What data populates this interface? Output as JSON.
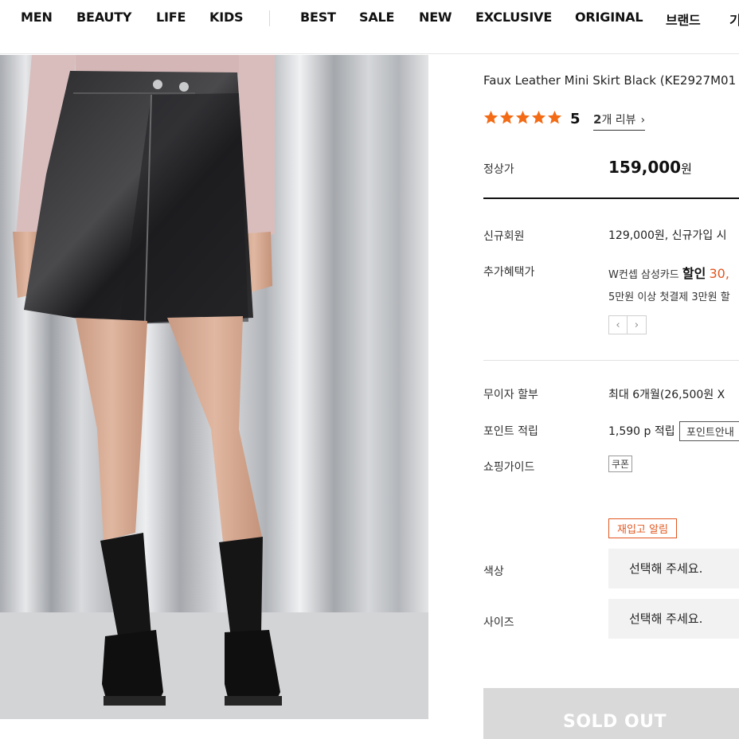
{
  "nav": {
    "items": [
      "MEN",
      "BEAUTY",
      "LIFE",
      "KIDS",
      "BEST",
      "SALE",
      "NEW",
      "EXCLUSIVE",
      "ORIGINAL",
      "브랜드",
      "기"
    ]
  },
  "product": {
    "name": "Faux Leather Mini Skirt Black (KE2927M01",
    "rating_value": 5,
    "rating_display": "5",
    "star_count": 5,
    "reviews_count": "2",
    "reviews_suffix": "개 리뷰",
    "list_price_label": "정상가",
    "list_price": "159,000",
    "currency": "원"
  },
  "benefits": {
    "new_member_label": "신규회원",
    "new_member_value": "129,000원, 신규가입 시",
    "extra_label": "추가혜택가",
    "extra_card": "W컨셉 삼성카드",
    "extra_discount_word": "할인",
    "extra_discount_amount": "30,",
    "extra_line2": "5만원 이상 첫결제 3만원 할",
    "prev_icon": "chevron-left-icon",
    "next_icon": "chevron-right-icon",
    "prev_glyph": "‹",
    "next_glyph": "›"
  },
  "payment": {
    "installment_label": "무이자 할부",
    "installment_value": "최대 6개월(26,500원 X",
    "points_label": "포인트 적립",
    "points_value": "1,590 p 적립",
    "points_guide_button": "포인트안내",
    "guide_label": "쇼핑가이드",
    "coupon_badge": "쿠폰"
  },
  "options": {
    "restock_button": "재입고 알림",
    "color_label": "색상",
    "color_placeholder": "선택해 주세요.",
    "size_label": "사이즈",
    "size_placeholder": "선택해 주세요."
  },
  "actions": {
    "soldout_label": "SOLD OUT"
  },
  "colors": {
    "accent": "#e2561f",
    "star": "#f36b14",
    "soldout_bg": "#d9d9d9"
  }
}
